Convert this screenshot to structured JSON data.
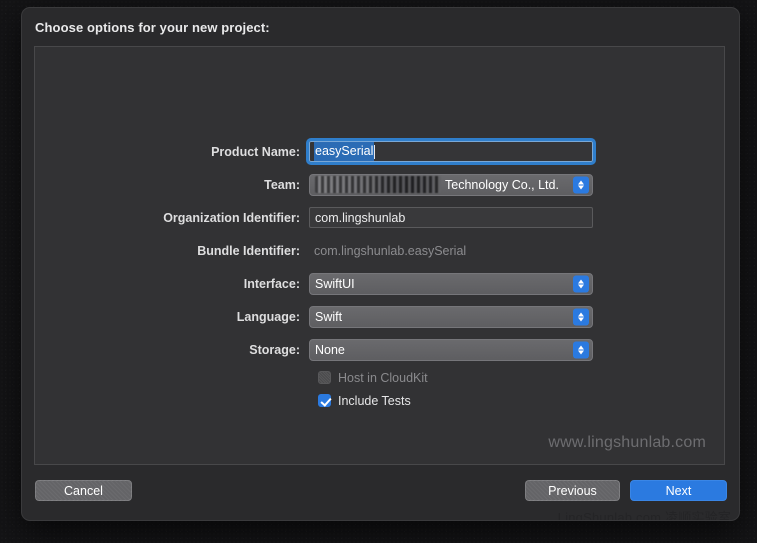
{
  "dialog": {
    "title": "Choose options for your new project:"
  },
  "form": {
    "rows": [
      {
        "label": "Product Name:",
        "type": "textfield-focused",
        "value": "easySerial"
      },
      {
        "label": "Team:",
        "type": "popup-redacted",
        "value": "Technology Co., Ltd."
      },
      {
        "label": "Organization Identifier:",
        "type": "textfield",
        "value": "com.lingshunlab"
      },
      {
        "label": "Bundle Identifier:",
        "type": "static",
        "value": "com.lingshunlab.easySerial"
      },
      {
        "label": "Interface:",
        "type": "popup",
        "value": "SwiftUI"
      },
      {
        "label": "Language:",
        "type": "popup",
        "value": "Swift"
      },
      {
        "label": "Storage:",
        "type": "popup",
        "value": "None"
      }
    ],
    "checkboxes": [
      {
        "label": "Host in CloudKit",
        "checked": false,
        "disabled": true
      },
      {
        "label": "Include Tests",
        "checked": true,
        "disabled": false
      }
    ]
  },
  "watermarks": {
    "panel": "www.lingshunlab.com",
    "footer": "LingShunlab.com 凌顺实验室"
  },
  "footer": {
    "cancel_label": "Cancel",
    "previous_label": "Previous",
    "next_label": "Next"
  },
  "colors": {
    "accent": "#2b7ae0",
    "selection": "#2b6cb5",
    "dialog_bg": "#2a2a2c",
    "panel_bg": "#323234"
  }
}
